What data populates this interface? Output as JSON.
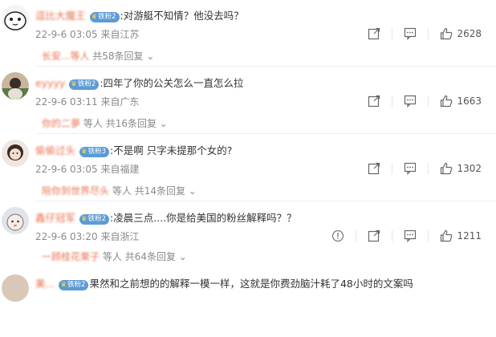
{
  "comments": [
    {
      "username": "逗比大魔王",
      "badge": "铁粉2",
      "text": ":对游艇不知情？他没去吗？",
      "time": "22-9-6 03:05",
      "location": "来自江苏",
      "replies_users": "长安...等人",
      "replies_count": "共58条回复",
      "likes": "2628",
      "avatar_colors": [
        "#f2f2f2",
        "#222222"
      ]
    },
    {
      "username": "eyyyy",
      "badge": "铁粉2",
      "text": ":四年了你的公关怎么一直怎么拉",
      "time": "22-9-6 03:11",
      "location": "来自广东",
      "replies_users": "你的二夢",
      "replies_tail": "等人",
      "replies_count": "共16条回复",
      "likes": "1663",
      "avatar_colors": [
        "#c9b39a",
        "#4a6b3a"
      ]
    },
    {
      "username": "偷偷过头",
      "badge": "铁粉3",
      "text": ":不是啊 只字未提那个女的?",
      "time": "22-9-6 03:05",
      "location": "来自福建",
      "replies_users": "陪你到世界尽头",
      "replies_tail": "等人",
      "replies_count": "共14条回复",
      "likes": "1302",
      "avatar_colors": [
        "#e9d7c8",
        "#3a2a22"
      ]
    },
    {
      "username": "鑫仔冠军",
      "badge": "铁粉2",
      "text": ":凌晨三点....你是给美国的粉丝解释吗？？",
      "time": "22-9-6 03:20",
      "location": "来自浙江",
      "replies_users": "一顾桂花栗子",
      "replies_tail": "等人",
      "replies_count": "共64条回复",
      "likes": "1211",
      "avatar_colors": [
        "#dde3ea",
        "#8a6a5a"
      ]
    }
  ],
  "partial_comment": {
    "username": "美...",
    "badge": "铁粉2",
    "text": "果然和之前想的的解释一模一样，这就是你费劲脑汁耗了48小时的文案吗"
  },
  "icons": {
    "share": "share-icon",
    "comment": "comment-icon",
    "like": "thumbs-up-icon",
    "report": "report-icon"
  },
  "colors": {
    "username": "#eb7350",
    "meta": "#8a8a8a",
    "badge": "#5b9bd5"
  }
}
